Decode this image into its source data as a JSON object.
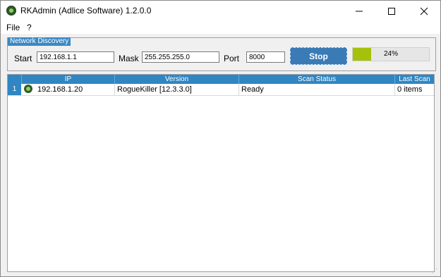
{
  "window": {
    "title": "RKAdmin (Adlice Software) 1.2.0.0"
  },
  "menu": {
    "items": [
      "File",
      "?"
    ]
  },
  "discovery": {
    "group_label": "Network Discovery",
    "start_label": "Start",
    "start_value": "192.168.1.1",
    "mask_label": "Mask",
    "mask_value": "255.255.255.0",
    "port_label": "Port",
    "port_value": "8000",
    "stop_label": "Stop",
    "progress_percent": 24,
    "progress_text": "24%"
  },
  "table": {
    "columns": [
      "IP",
      "Version",
      "Scan Status",
      "Last Scan"
    ],
    "rows": [
      {
        "num": "1",
        "ip": "192.168.1.20",
        "version": "RogueKiller [12.3.3.0]",
        "status": "Ready",
        "last_scan": "0 items"
      }
    ]
  },
  "colors": {
    "accent": "#2f86c2",
    "stop_button": "#3a7bb6",
    "progress_fill": "#a6c10a"
  }
}
